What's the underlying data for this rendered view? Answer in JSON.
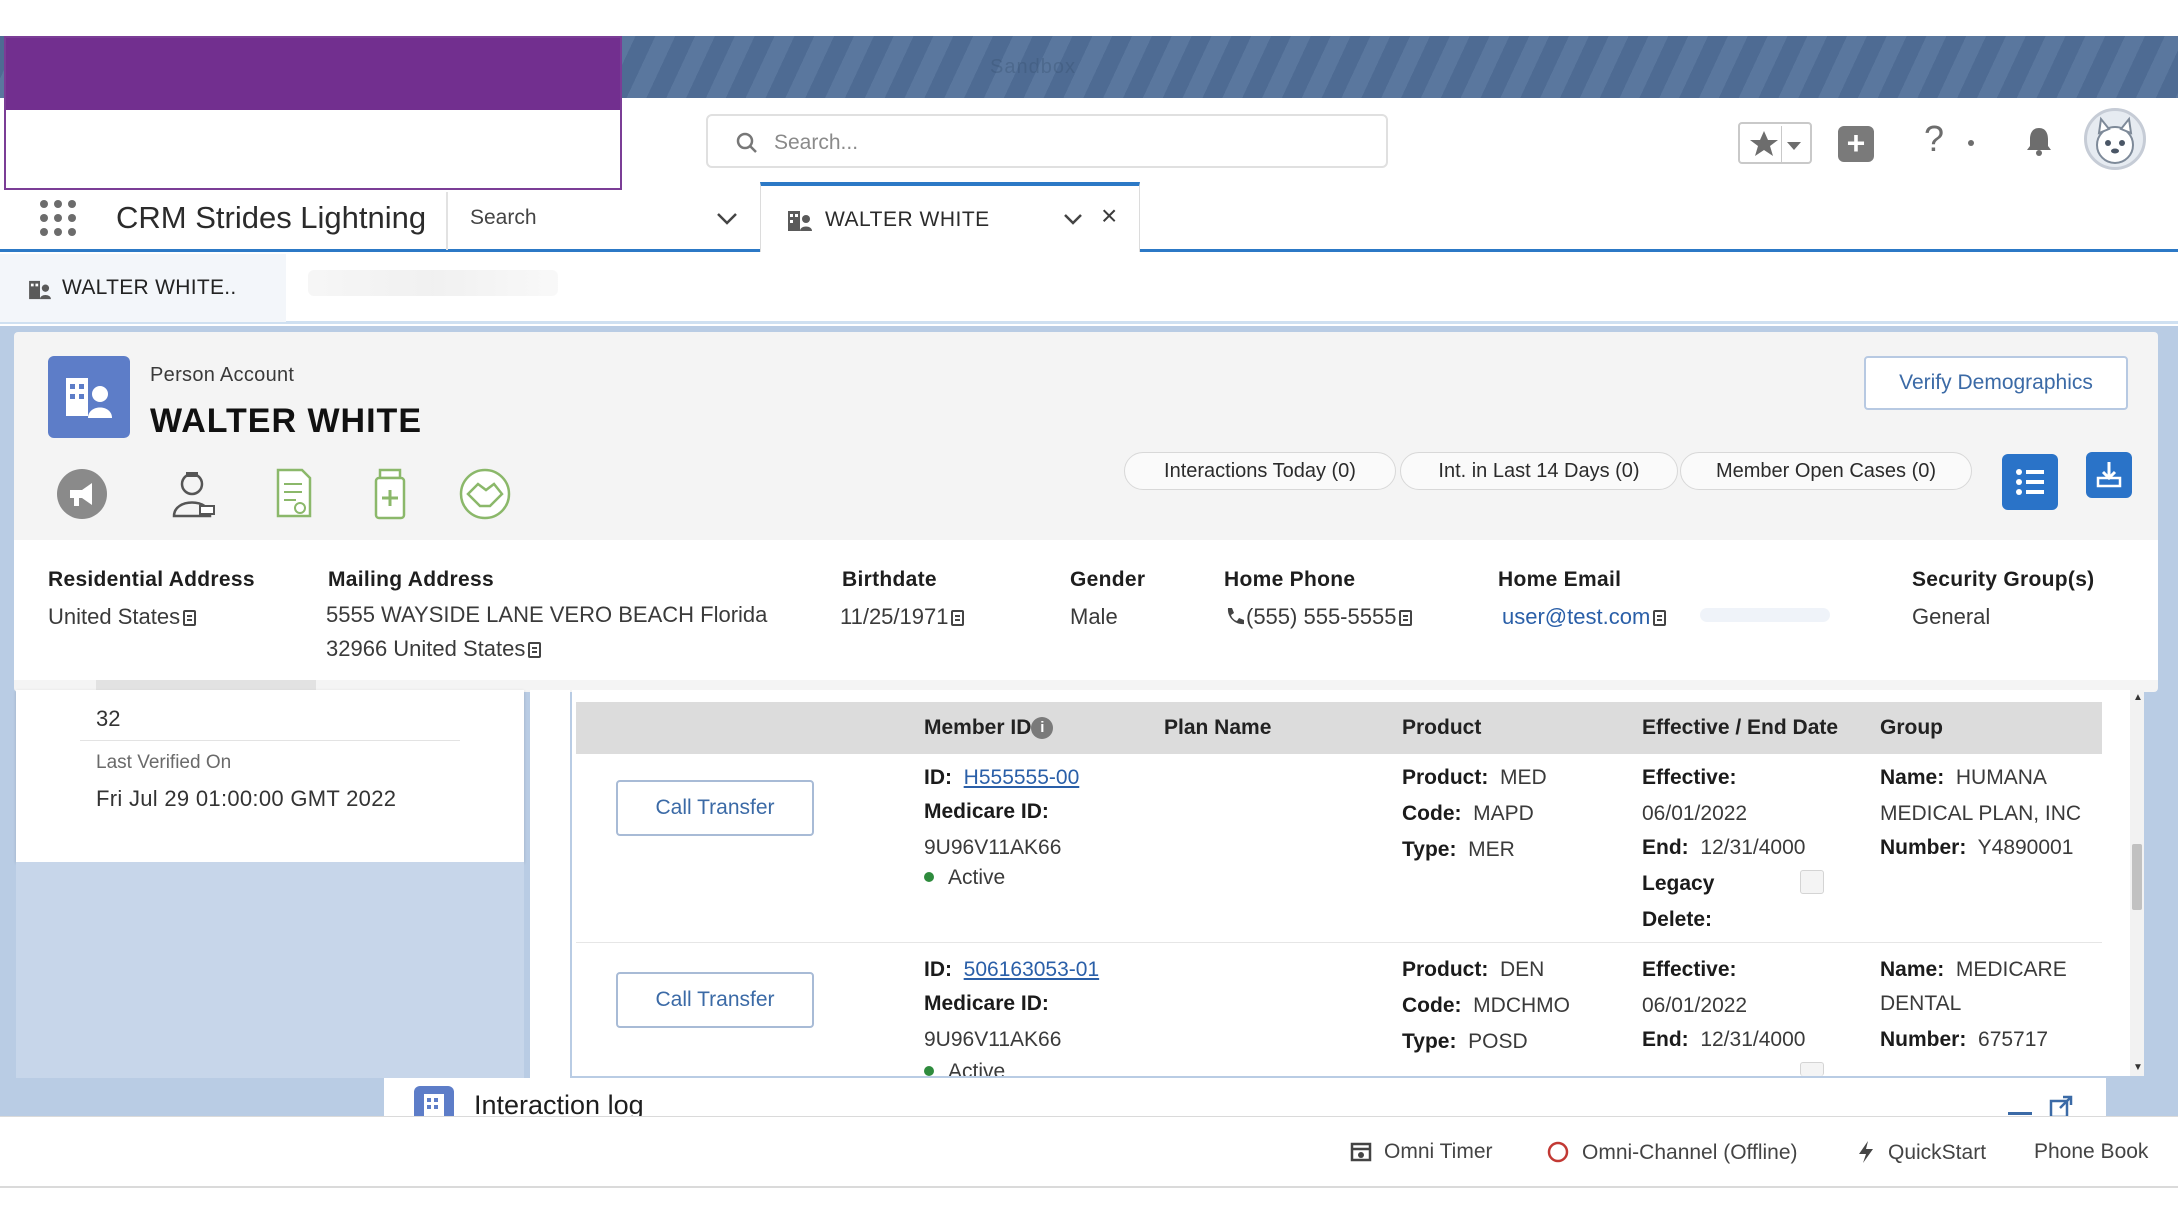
{
  "header": {
    "sandbox_label": "Sandbox",
    "search_placeholder": "Search..."
  },
  "nav": {
    "app_name": "CRM Strides Lightning",
    "search_label": "Search",
    "tab_label": "WALTER WHITE"
  },
  "subtab": {
    "label": "WALTER WHITE.."
  },
  "record": {
    "type": "Person Account",
    "name": "WALTER WHITE",
    "verify_button": "Verify Demographics",
    "pills": [
      "Interactions Today (0)",
      "Int. in Last 14 Days (0)",
      "Member Open Cases (0)"
    ],
    "quick_actions": [
      "megaphone-icon",
      "person-badge-icon",
      "document-icon",
      "bottle-icon",
      "handshake-icon"
    ]
  },
  "fields": {
    "residential_label": "Residential Address",
    "residential_value": "United States",
    "mailing_label": "Mailing Address",
    "mailing_line1": "5555 WAYSIDE LANE VERO BEACH Florida",
    "mailing_line2": "32966 United States",
    "birthdate_label": "Birthdate",
    "birthdate_value": "11/25/1971",
    "gender_label": "Gender",
    "gender_value": "Male",
    "home_phone_label": "Home Phone",
    "home_phone_value": "(555) 555-5555",
    "home_email_label": "Home Email",
    "home_email_value": "user@test.com",
    "security_label": "Security Group(s)",
    "security_value": "General"
  },
  "left_card": {
    "count_value": "32",
    "last_verified_label": "Last Verified On",
    "last_verified_value": "Fri Jul 29 01:00:00 GMT 2022"
  },
  "table": {
    "headers": [
      "Member ID",
      "Plan Name",
      "Product",
      "Effective / End Date",
      "Group"
    ],
    "rows": [
      {
        "button": "Call Transfer",
        "id_label": "ID:",
        "id_value": "H555555-00",
        "medicare_label": "Medicare ID:",
        "medicare_value": "9U96V11AK66",
        "status": "Active",
        "product_label": "Product:",
        "product_value": "MED",
        "code_label": "Code:",
        "code_value": "MAPD",
        "type_label": "Type:",
        "type_value": "MER",
        "effective_label": "Effective:",
        "effective_value": "06/01/2022",
        "end_label": "End:",
        "end_value": "12/31/4000",
        "legacy_label": "Legacy",
        "delete_label": "Delete:",
        "group_name_label": "Name:",
        "group_name_value": "HUMANA",
        "group_name_value2": "MEDICAL PLAN, INC",
        "group_number_label": "Number:",
        "group_number_value": "Y4890001"
      },
      {
        "button": "Call Transfer",
        "id_label": "ID:",
        "id_value": "506163053-01",
        "medicare_label": "Medicare ID:",
        "medicare_value": "9U96V11AK66",
        "status": "Active",
        "product_label": "Product:",
        "product_value": "DEN",
        "code_label": "Code:",
        "code_value": "MDCHMO",
        "type_label": "Type:",
        "type_value": "POSD",
        "effective_label": "Effective:",
        "effective_value": "06/01/2022",
        "end_label": "End:",
        "end_value": "12/31/4000",
        "group_name_label": "Name:",
        "group_name_value": "MEDICARE",
        "group_name_value2": "DENTAL",
        "group_number_label": "Number:",
        "group_number_value": "675717"
      }
    ]
  },
  "interaction_log": {
    "label": "Interaction log"
  },
  "utility": {
    "omni_timer": "Omni Timer",
    "omni_channel": "Omni-Channel (Offline)",
    "quickstart": "QuickStart",
    "phone_book": "Phone Book"
  },
  "colors": {
    "brand_purple": "#722f8f",
    "header_blue": "#4e6b93",
    "accent_blue": "#2a73c8",
    "workspace_bg": "#b9cce4",
    "active_green": "#2e8b3d",
    "offline_red": "#c23934"
  }
}
